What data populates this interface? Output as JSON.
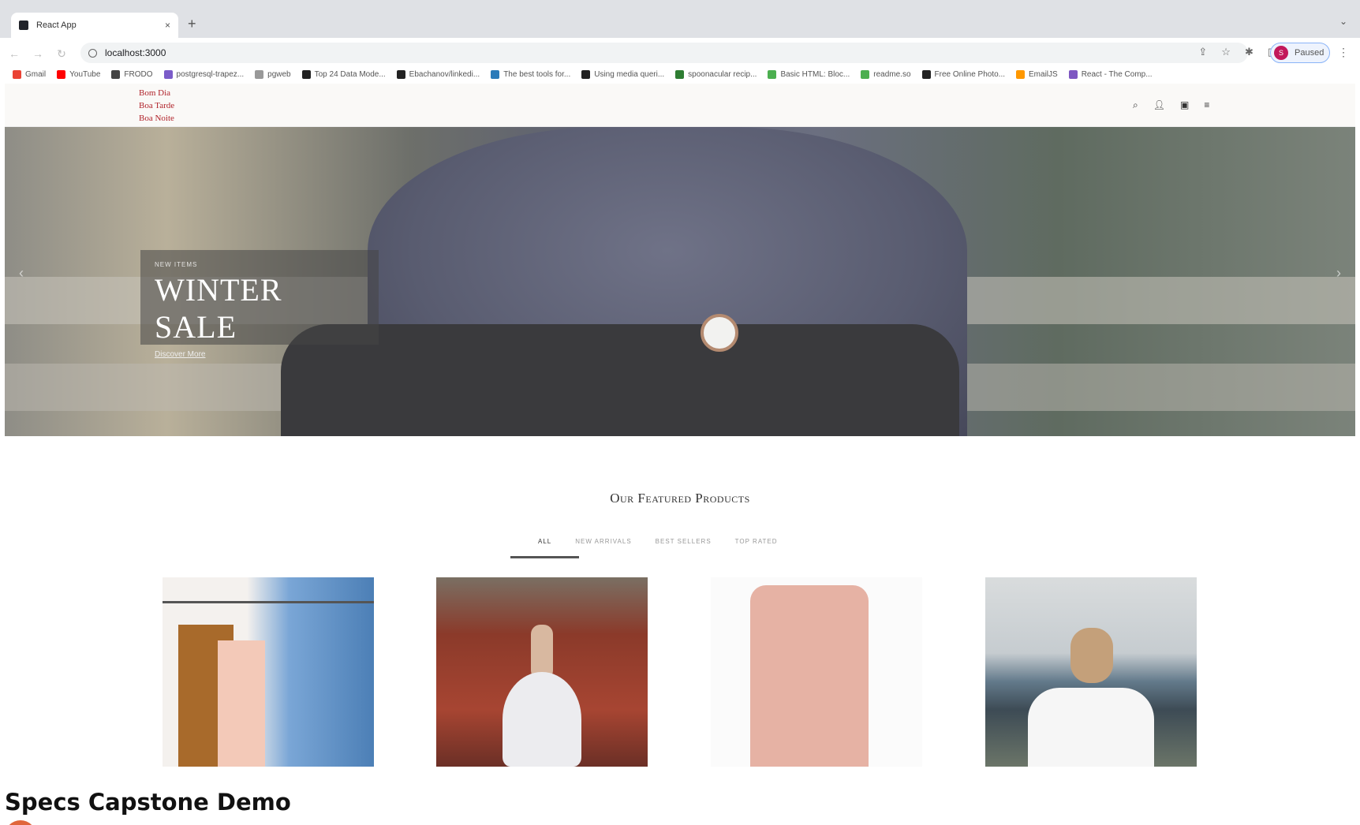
{
  "browser": {
    "tab_title": "React App",
    "tab_close": "×",
    "new_tab": "+",
    "url": "localhost:3000",
    "profile_initial": "S",
    "profile_status": "Paused",
    "bookmarks": [
      {
        "label": "Gmail",
        "color": "#ea4335"
      },
      {
        "label": "YouTube",
        "color": "#ff0000"
      },
      {
        "label": "FRODO",
        "color": "#444444"
      },
      {
        "label": "postgresql-trapez...",
        "color": "#7b5cc9"
      },
      {
        "label": "pgweb",
        "color": "#999999"
      },
      {
        "label": "Top 24 Data Mode...",
        "color": "#222222"
      },
      {
        "label": "Ebachanov/linkedi...",
        "color": "#222222"
      },
      {
        "label": "The best tools for...",
        "color": "#2b7bb9"
      },
      {
        "label": "Using media queri...",
        "color": "#222222"
      },
      {
        "label": "spoonacular recip...",
        "color": "#2e7d32"
      },
      {
        "label": "Basic HTML: Bloc...",
        "color": "#4caf50"
      },
      {
        "label": "readme.so",
        "color": "#4caf50"
      },
      {
        "label": "Free Online Photo...",
        "color": "#222222"
      },
      {
        "label": "EmailJS",
        "color": "#ff9800"
      },
      {
        "label": "React - The Comp...",
        "color": "#7e57c2"
      }
    ]
  },
  "site": {
    "greetings": [
      "Bom Dia",
      "Boa Tarde",
      "Boa Noite"
    ],
    "header_icons": [
      "search-icon",
      "user-icon",
      "bag-icon",
      "menu-icon"
    ],
    "hero": {
      "kicker": "NEW ITEMS",
      "headline": "WINTER SALE",
      "link": "Discover More"
    },
    "featured_title": "Our Featured Products",
    "filters": [
      "ALL",
      "NEW ARRIVALS",
      "BEST SELLERS",
      "TOP RATED"
    ]
  },
  "video": {
    "title": "Specs Capstone Demo"
  }
}
